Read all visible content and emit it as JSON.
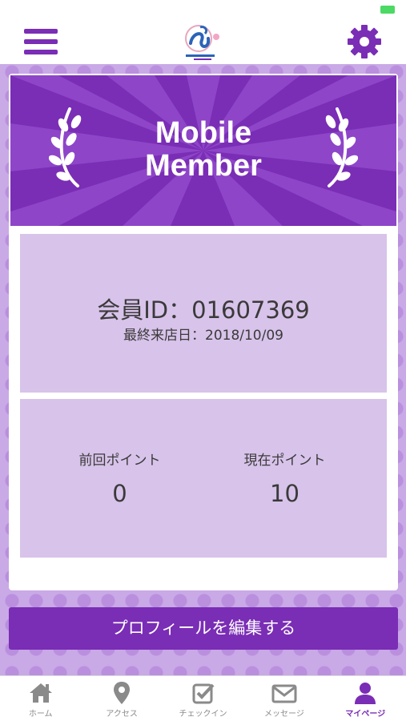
{
  "colors": {
    "accent": "#7a2db5",
    "panel": "#d8c3ea",
    "inactive_tab": "#8a8a8a"
  },
  "header": {
    "menu_icon": "hamburger-menu-icon",
    "logo_icon": "shop-logo-icon",
    "settings_icon": "gear-icon"
  },
  "banner": {
    "title_line1": "Mobile",
    "title_line2": "Member"
  },
  "member": {
    "id_text": "会員ID：01607369",
    "last_visit_text": "最終来店日：2018/10/09"
  },
  "points": {
    "previous_label": "前回ポイント",
    "previous_value": "0",
    "current_label": "現在ポイント",
    "current_value": "10"
  },
  "edit_profile_label": "プロフィールを編集する",
  "tabs": [
    {
      "label": "ホーム",
      "icon": "home-icon"
    },
    {
      "label": "アクセス",
      "icon": "map-pin-icon"
    },
    {
      "label": "チェックイン",
      "icon": "checkin-icon"
    },
    {
      "label": "メッセージ",
      "icon": "mail-icon"
    },
    {
      "label": "マイページ",
      "icon": "user-icon"
    }
  ]
}
